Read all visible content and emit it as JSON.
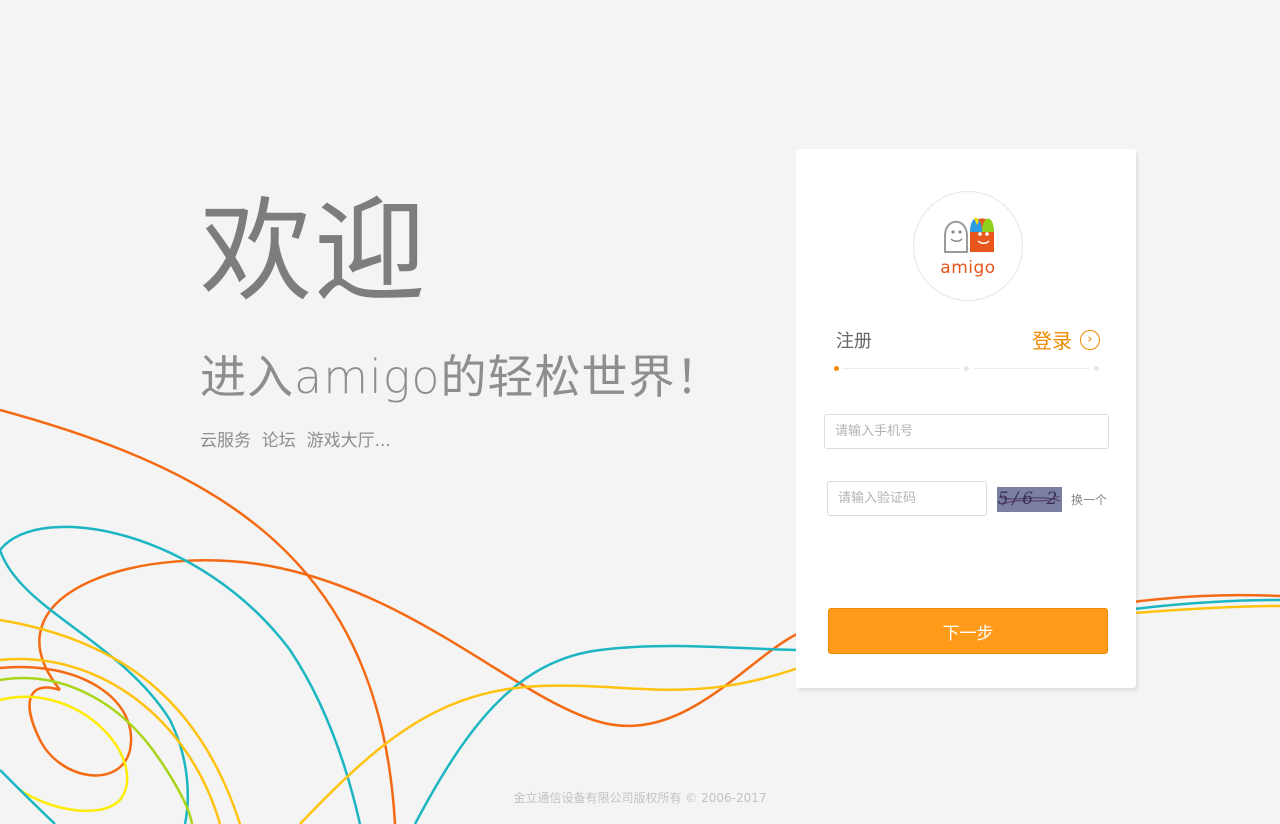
{
  "colors": {
    "accent": "#f08a00",
    "button": "#ff9a1a",
    "brand_logo": "#e9561b"
  },
  "hero": {
    "title": "欢迎",
    "subtitle": "进入amigo的轻松世界！",
    "services": "云服务  论坛  游戏大厅..."
  },
  "card": {
    "logo_text": "amigo",
    "tabs": {
      "register": "注册",
      "login": "登录"
    },
    "steps_total": 3,
    "steps_current": 1,
    "phone_placeholder": "请输入手机号",
    "code_placeholder": "请输入验证码",
    "captcha_text": "5/6 2",
    "refresh_label": "换一个",
    "next_button": "下一步"
  },
  "footer": {
    "copyright": "金立通信设备有限公司版权所有 © 2006-2017"
  },
  "icons": {
    "login_arrow": "chevron-right-circle-icon"
  }
}
